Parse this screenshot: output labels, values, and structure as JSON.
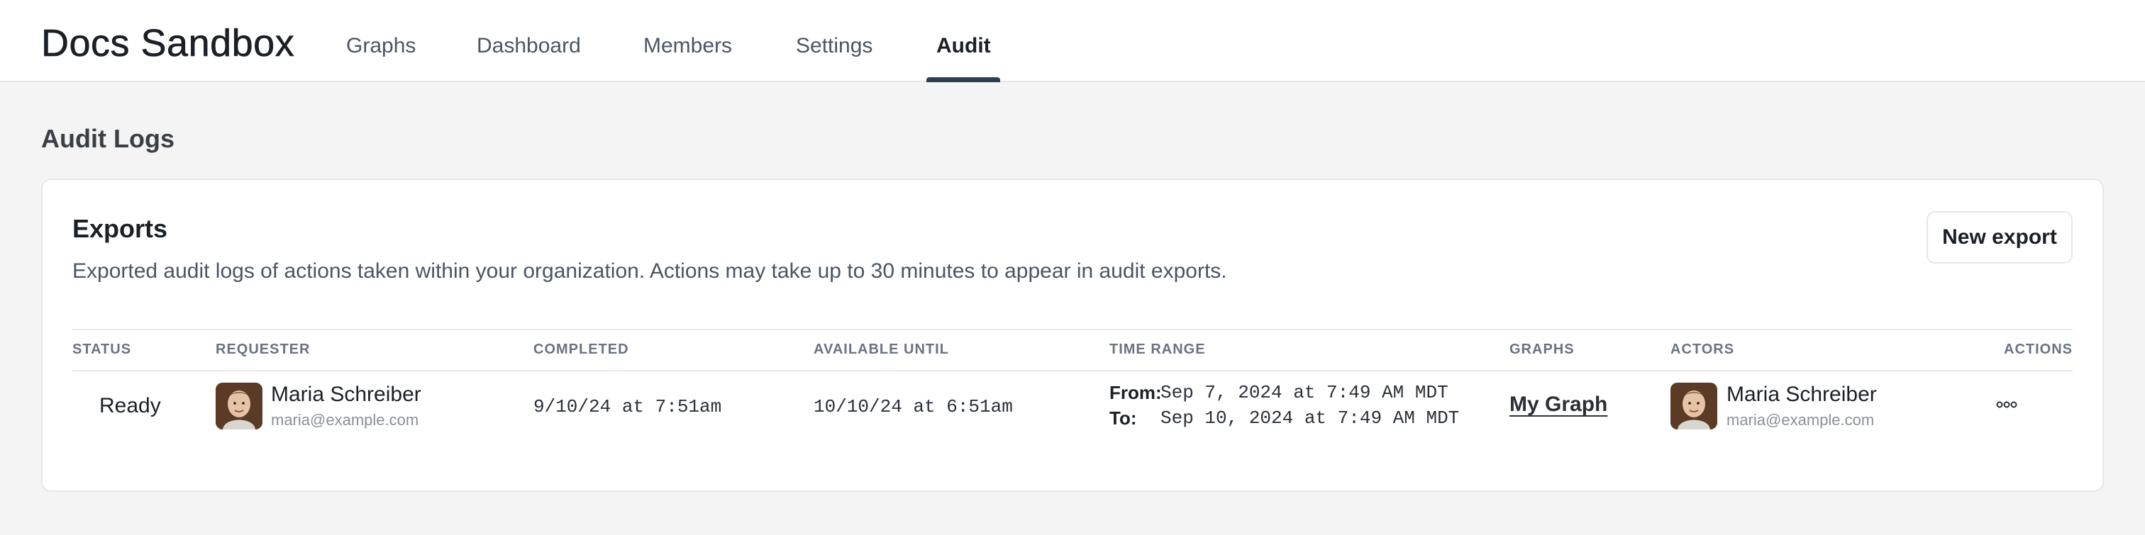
{
  "header": {
    "brand": "Docs Sandbox",
    "nav": [
      {
        "label": "Graphs"
      },
      {
        "label": "Dashboard"
      },
      {
        "label": "Members"
      },
      {
        "label": "Settings"
      },
      {
        "label": "Audit",
        "active": true
      }
    ]
  },
  "page": {
    "title": "Audit Logs"
  },
  "exports": {
    "title": "Exports",
    "description": "Exported audit logs of actions taken within your organization. Actions may take up to 30 minutes to appear in audit exports.",
    "new_button": "New export",
    "columns": [
      "STATUS",
      "REQUESTER",
      "COMPLETED",
      "AVAILABLE UNTIL",
      "TIME RANGE",
      "GRAPHS",
      "ACTORS",
      "ACTIONS"
    ],
    "rows": [
      {
        "status": "Ready",
        "requester": {
          "name": "Maria Schreiber",
          "email": "maria@example.com"
        },
        "completed": "9/10/24 at 7:51am",
        "available_until": "10/10/24 at 6:51am",
        "time_range": {
          "from_label": "From:",
          "from": "Sep 7, 2024 at 7:49 AM MDT",
          "to_label": "To:",
          "to": "Sep 10, 2024 at 7:49 AM MDT"
        },
        "graph": "My Graph",
        "actor": {
          "name": "Maria Schreiber",
          "email": "maria@example.com"
        },
        "actions_icon": "more-horizontal-icon"
      }
    ]
  },
  "colors": {
    "page_bg": "#f3f4f3",
    "card_bg": "#ffffff",
    "active_tab_indicator": "#2c3e50",
    "muted_text": "#6b7280"
  }
}
